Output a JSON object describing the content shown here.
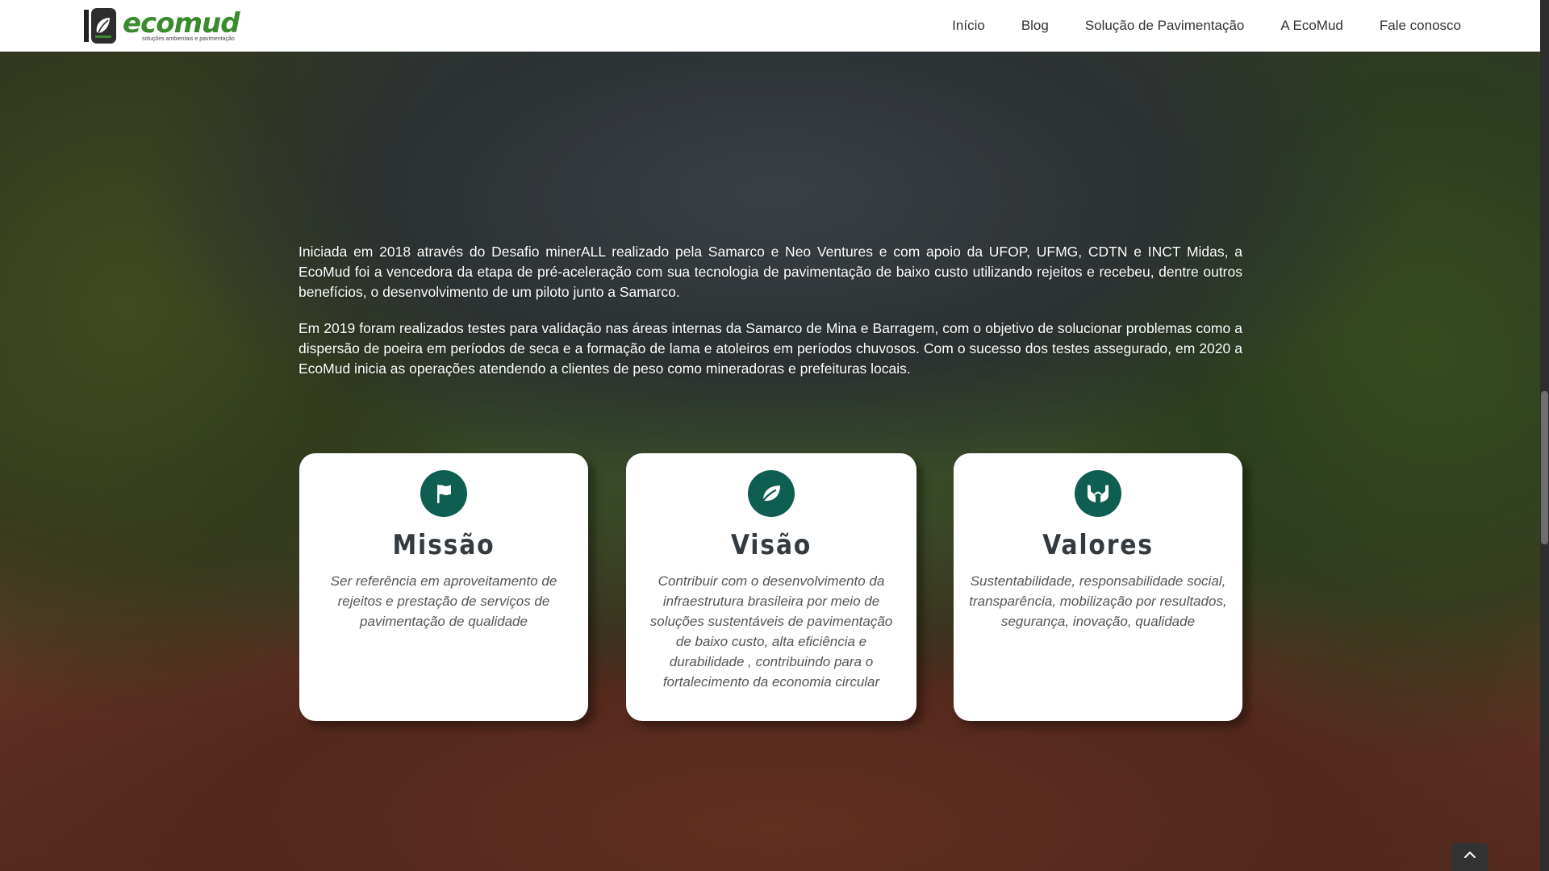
{
  "brand": {
    "logo_word": "ecomud",
    "logo_tagline": "soluções ambientais e pavimentação",
    "primary_color": "#0f5e52",
    "logo_green": "#3a8a2e"
  },
  "nav": {
    "items": [
      {
        "label": "Início"
      },
      {
        "label": "Blog"
      },
      {
        "label": "Solução de Pavimentação"
      },
      {
        "label": "A EcoMud"
      },
      {
        "label": "Fale conosco"
      }
    ]
  },
  "intro": {
    "paragraphs": [
      "Iniciada em 2018 através do Desafio minerALL realizado pela Samarco e Neo Ventures e com apoio da UFOP, UFMG, CDTN e INCT Midas, a EcoMud foi a vencedora da etapa de pré-aceleração com sua tecnologia de pavimentação de baixo custo utilizando rejeitos e recebeu, dentre outros benefícios, o desenvolvimento de um piloto junto a Samarco.",
      "Em 2019 foram realizados testes para validação nas áreas internas da Samarco de Mina e Barragem, com o objetivo de solucionar problemas como a dispersão de poeira em períodos de seca e a formação de lama e atoleiros em períodos chuvosos. Com o sucesso dos testes assegurado, em 2020 a EcoMud inicia as operações atendendo a clientes de peso como mineradoras e prefeituras locais."
    ]
  },
  "cards": [
    {
      "icon": "flag-icon",
      "title": "Missão",
      "text": "Ser referência em aproveitamento de rejeitos e prestação de serviços de pavimentação de qualidade"
    },
    {
      "icon": "leaf-icon",
      "title": "Visão",
      "text": "Contribuir com o desenvolvimento da infraestrutura brasileira por meio de soluções sustentáveis de pavimentação de baixo custo, alta eficiência e durabilidade , contribuindo para o fortalecimento da economia circular"
    },
    {
      "icon": "hands-icon",
      "title": "Valores",
      "text": "Sustentabilidade, responsabilidade social, transparência, mobilização por resultados, segurança, inovação, qualidade"
    }
  ],
  "back_to_top": {
    "icon": "chevron-up-icon"
  }
}
